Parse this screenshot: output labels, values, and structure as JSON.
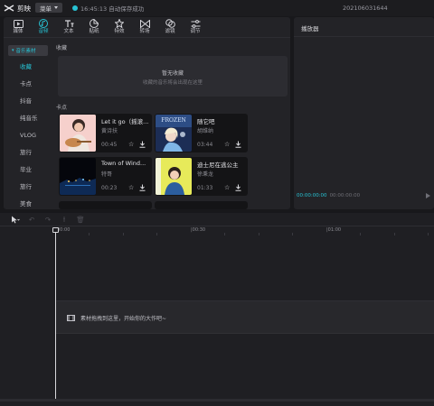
{
  "app": {
    "name": "剪映",
    "menu_label": "菜单",
    "save_status": "16:45:13 自动保存成功",
    "project_name": "202106031644"
  },
  "tools": [
    {
      "label": "媒体",
      "icon": "media-icon"
    },
    {
      "label": "音频",
      "icon": "audio-icon",
      "active": true
    },
    {
      "label": "文本",
      "icon": "text-icon"
    },
    {
      "label": "贴纸",
      "icon": "sticker-icon"
    },
    {
      "label": "特效",
      "icon": "effects-icon"
    },
    {
      "label": "转场",
      "icon": "transition-icon"
    },
    {
      "label": "滤镜",
      "icon": "filter-icon"
    },
    {
      "label": "调节",
      "icon": "adjust-icon"
    }
  ],
  "sidebar": {
    "header": "音乐素材",
    "items": [
      {
        "label": "收藏",
        "active": true
      },
      {
        "label": "卡点"
      },
      {
        "label": "抖音"
      },
      {
        "label": "纯音乐"
      },
      {
        "label": "VLOG"
      },
      {
        "label": "旅行"
      },
      {
        "label": "毕业"
      },
      {
        "label": "旅行"
      },
      {
        "label": "美食"
      }
    ]
  },
  "favorites": {
    "label": "收藏",
    "empty_title": "暂无收藏",
    "empty_sub": "收藏的音乐将会出现在这里"
  },
  "beats": {
    "label": "卡点",
    "songs": [
      {
        "title": "Let it go（摇滚...",
        "artist": "黄诗扶",
        "duration": "00:45"
      },
      {
        "title": "随它吧",
        "artist": "胡维纳",
        "duration": "03:44"
      },
      {
        "title": "Town of Wind...",
        "artist": "特哥",
        "duration": "00:23"
      },
      {
        "title": "迪士尼在逃公主",
        "artist": "徐秉龙",
        "duration": "01:33"
      }
    ]
  },
  "player": {
    "title": "播放器",
    "time_current": "00:00:00:00",
    "time_total": "00:00:00:00"
  },
  "timeline": {
    "ruler_labels": [
      "00:00",
      "|00:30",
      "|01:00"
    ],
    "drop_hint": "素材拖拽到这里，开始你的大作吧~"
  },
  "colors": {
    "accent": "#27c2d3",
    "panel": "#232327",
    "background": "#18181b"
  }
}
